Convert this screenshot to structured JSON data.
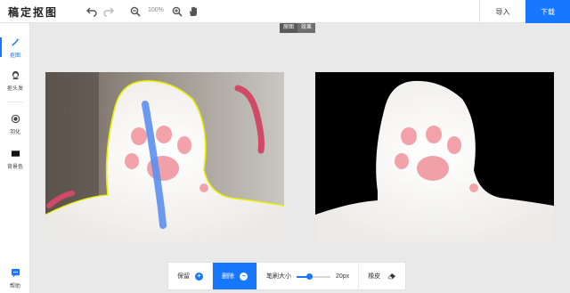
{
  "app": {
    "logo": "稿定抠图"
  },
  "toolbar": {
    "undo_icon": "undo-icon",
    "redo_icon": "redo-icon",
    "zoom_out_icon": "zoom-out-icon",
    "zoom_value": "100%",
    "zoom_in_icon": "zoom-in-icon",
    "pan_icon": "hand-icon",
    "import_label": "导入",
    "download_label": "下载",
    "accent_color": "#1777ff"
  },
  "sidebar": {
    "items": [
      {
        "label": "抠图",
        "icon": "magic-wand-icon",
        "active": true
      },
      {
        "label": "抠头发",
        "icon": "head-icon",
        "active": false
      },
      {
        "label": "羽化",
        "icon": "feather-icon",
        "active": false
      },
      {
        "label": "背景色",
        "icon": "background-color-icon",
        "active": false
      }
    ],
    "help_label": "帮助",
    "help_icon": "help-chat-icon"
  },
  "view_toggle": {
    "original_label": "原图",
    "effect_label": "效果"
  },
  "canvas": {
    "left": {
      "name": "original-image",
      "strokes": {
        "keep_color": "#5b8ff0",
        "remove_color": "#d04a68",
        "outline_color": "#e8f000"
      }
    },
    "right": {
      "name": "result-preview",
      "background": "#000000"
    }
  },
  "bottom": {
    "keep_label": "保留",
    "remove_label": "删除",
    "brush_label": "笔刷大小",
    "brush_value": "20px",
    "brush_level": 0.37,
    "eraser_label": "橡皮"
  }
}
